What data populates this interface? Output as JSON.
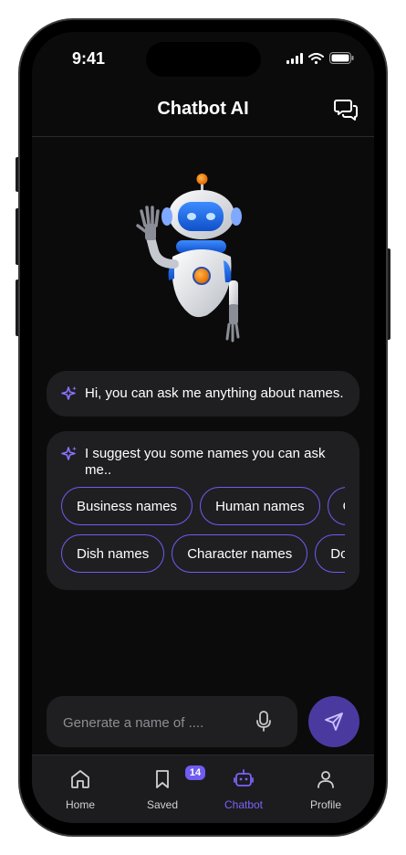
{
  "status_bar": {
    "time": "9:41"
  },
  "header": {
    "title": "Chatbot AI",
    "chat_icon": "chat-bubbles-icon"
  },
  "greeting": {
    "text": "Hi, you can ask me anything about names.",
    "icon": "sparkle-icon"
  },
  "suggestions": {
    "intro": "I suggest you some names you can ask me..",
    "row1": [
      "Business names",
      "Human names",
      "Game names"
    ],
    "row2": [
      "Dish names",
      "Character names",
      "Dog names"
    ]
  },
  "composer": {
    "placeholder": "Generate a name of ....",
    "mic_icon": "mic-icon",
    "send_icon": "send-icon"
  },
  "tabbar": {
    "items": [
      {
        "label": "Home",
        "icon": "home-icon"
      },
      {
        "label": "Saved",
        "icon": "bookmark-icon",
        "badge": "14"
      },
      {
        "label": "Chatbot",
        "icon": "robot-icon",
        "active": true
      },
      {
        "label": "Profile",
        "icon": "profile-icon"
      }
    ]
  },
  "colors": {
    "accent": "#7a63f6",
    "background": "#0b0b0c",
    "bubble": "#1f1f22",
    "send_button": "#4a3aa0"
  }
}
